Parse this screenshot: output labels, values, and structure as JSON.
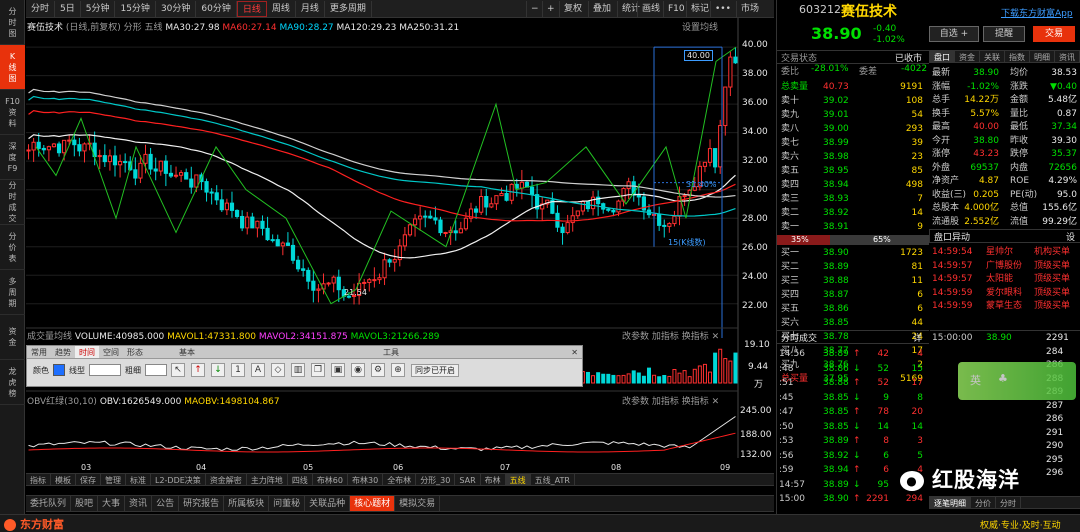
{
  "left_nav": [
    "分时图",
    "K线图",
    "F10资料",
    "深度F9",
    "分时成交",
    "分价表",
    "多周期",
    "资金",
    "龙虎榜"
  ],
  "timeframes": [
    "分时",
    "5日",
    "5分钟",
    "15分钟",
    "30分钟",
    "60分钟",
    "日线",
    "周线",
    "月线",
    "更多周期"
  ],
  "top_right": {
    "fuquan": "复权",
    "overlay": "叠加",
    "stat": "统计",
    "draw": "画线",
    "f10": "F10",
    "shortcut": "标记",
    "more": "•••",
    "market": "市场"
  },
  "chart_header": {
    "name": "赛伍技术",
    "info": "(日线,前复权) 分形 五线",
    "ma30": "MA30:27.98",
    "ma60": "MA60:27.14",
    "ma90": "MA90:28.27",
    "ma120": "MA120:29.23",
    "ma250": "MA250:31.21",
    "settings": "设置均线"
  },
  "price_axis": [
    "40.00",
    "38.00",
    "36.00",
    "34.00",
    "32.00",
    "30.00",
    "28.00",
    "26.00",
    "24.00",
    "22.00"
  ],
  "annotations": {
    "top_price": "40.00",
    "low_price": "21.54",
    "pct": "31.40%",
    "kbars": "15(K线数)"
  },
  "vol_header": {
    "label": "成交量均线",
    "vol": "VOLUME:40985.000",
    "mavol1": "MAVOL1:47331.800",
    "mavol2": "MAVOL2:34151.875",
    "mavol3": "MAVOL3:21266.289",
    "params": "改参数",
    "add": "加指标",
    "switch": "换指标"
  },
  "vol_axis": [
    "19.10",
    "9.44",
    "万"
  ],
  "obv_header": {
    "label": "OBV红绿(30,10)",
    "obv": "OBV:1626549.000",
    "maobv": "MAOBV:1498104.867"
  },
  "obv_axis": [
    "245.00",
    "188.00",
    "132.00"
  ],
  "x_axis": [
    "03",
    "04",
    "05",
    "06",
    "07",
    "08",
    "09"
  ],
  "toolbox": {
    "tabs": [
      "常用",
      "趋势",
      "时间",
      "空间",
      "形态"
    ],
    "section1": "基本",
    "section2": "工具",
    "color_label": "颜色",
    "line_label": "线型",
    "width_label": "粗细",
    "sync": "同步已开启"
  },
  "chart_tabs": [
    "指标",
    "模板",
    "保存",
    "管理",
    "标准",
    "L2-DDE决策",
    "资金解密",
    "主力阵地",
    "四线",
    "布林60",
    "布林30",
    "全布林",
    "分形_30",
    "SAR",
    "布林",
    "五线",
    "五线_ATR"
  ],
  "bottom_tabs": [
    "委托队列",
    "股吧",
    "大事",
    "资讯",
    "公告",
    "研究报告",
    "所属板块",
    "问董秘",
    "关联品种",
    "核心题材",
    "模拟交易"
  ],
  "logo": "东方财富",
  "slogan": "权威·专业·及时·互动",
  "right_panel": {
    "code": "603212",
    "name": "赛伍技术",
    "download": "下载东方财富App",
    "price": "38.90",
    "chg": "-0.40",
    "pct": "-1.02%",
    "btn_self": "自选 +",
    "btn_alert": "提醒",
    "btn_trade": "交易",
    "status_label": "交易状态",
    "status": "已收市",
    "tabs": [
      "盘口",
      "资金",
      "关联",
      "指数",
      "明细",
      "资讯"
    ],
    "weibi_label": "委比",
    "weibi": "-28.01%",
    "weicha_label": "委差",
    "weicha": "-4022",
    "sell_total_label": "总卖量",
    "sell_total_price": "40.73",
    "sell_total_vol": "9191",
    "sells": [
      [
        "卖十",
        "39.02",
        "108"
      ],
      [
        "卖九",
        "39.01",
        "54"
      ],
      [
        "卖八",
        "39.00",
        "293"
      ],
      [
        "卖七",
        "38.99",
        "39"
      ],
      [
        "卖六",
        "38.98",
        "23"
      ],
      [
        "卖五",
        "38.95",
        "85"
      ],
      [
        "卖四",
        "38.94",
        "498"
      ],
      [
        "卖三",
        "38.93",
        "7"
      ],
      [
        "卖二",
        "38.92",
        "14"
      ],
      [
        "卖一",
        "38.91",
        "9"
      ]
    ],
    "ratio_left": "35%",
    "ratio_right": "65%",
    "buys": [
      [
        "买一",
        "38.90",
        "1723"
      ],
      [
        "买二",
        "38.89",
        "81"
      ],
      [
        "买三",
        "38.88",
        "11"
      ],
      [
        "买四",
        "38.87",
        "6"
      ],
      [
        "买五",
        "38.86",
        "6"
      ],
      [
        "买六",
        "38.85",
        "44"
      ],
      [
        "买七",
        "38.78",
        "24"
      ],
      [
        "买八",
        "38.77",
        "17"
      ],
      [
        "买九",
        "38.76",
        "2"
      ]
    ],
    "buy_total_label": "总买量",
    "buy_total_price": "37.95",
    "buy_total_vol": "5169",
    "ticks_title": "分时成交",
    "ticks_more": "详",
    "ticks": [
      [
        "14:56",
        "38.89",
        "42",
        "4"
      ],
      [
        ":48",
        "38.86",
        "52",
        "15"
      ],
      [
        ":51",
        "38.88",
        "52",
        "17"
      ],
      [
        ":45",
        "38.85",
        "9",
        "8"
      ],
      [
        ":47",
        "38.85",
        "78",
        "20"
      ],
      [
        ":50",
        "38.85",
        "14",
        "14"
      ],
      [
        ":53",
        "38.89",
        "8",
        "3"
      ],
      [
        ":56",
        "38.92",
        "6",
        "5"
      ],
      [
        ":59",
        "38.94",
        "6",
        "4"
      ],
      [
        "14:57",
        "38.89",
        "95",
        "23"
      ],
      [
        "15:00",
        "38.90",
        "2291",
        "294"
      ]
    ],
    "stats": [
      [
        "最新",
        "38.90",
        "均价",
        "38.53"
      ],
      [
        "涨幅",
        "-1.02%",
        "涨跌",
        "▼0.40"
      ],
      [
        "总手",
        "14.22万",
        "金额",
        "5.48亿"
      ],
      [
        "换手",
        "5.57%",
        "量比",
        "0.87"
      ],
      [
        "最高",
        "40.00",
        "最低",
        "37.34"
      ],
      [
        "今开",
        "38.80",
        "昨收",
        "39.30"
      ],
      [
        "涨停",
        "43.23",
        "跌停",
        "35.37"
      ],
      [
        "外盘",
        "69537",
        "内盘",
        "72656"
      ],
      [
        "净资产",
        "4.87",
        "ROE",
        "4.29%"
      ],
      [
        "收益(三)",
        "0.205",
        "PE(动)",
        "95.0"
      ],
      [
        "总股本",
        "4.000亿",
        "总值",
        "155.6亿"
      ],
      [
        "流通股",
        "2.552亿",
        "流值",
        "99.29亿"
      ]
    ],
    "anomaly_title": "盘口异动",
    "anomaly_set": "设",
    "anomalies": [
      [
        "14:59:54",
        "星帅尔",
        "机构买单"
      ],
      [
        "14:59:57",
        "广博股份",
        "顶级买单"
      ],
      [
        "14:59:57",
        "太阳能",
        "顶级买单"
      ],
      [
        "14:59:59",
        "爱尔眼科",
        "顶级买单"
      ],
      [
        "14:59:59",
        "蒙草生态",
        "顶级买单"
      ]
    ],
    "mini_ticks": [
      [
        "15:00:00",
        "38.90",
        "2291"
      ],
      [
        "",
        "",
        "284"
      ],
      [
        "",
        "",
        "286"
      ],
      [
        "",
        "",
        "288"
      ],
      [
        "",
        "",
        "289"
      ],
      [
        "",
        "",
        "287"
      ],
      [
        "",
        "",
        "286"
      ],
      [
        "",
        "",
        "291"
      ],
      [
        "",
        "",
        "290"
      ],
      [
        "",
        "",
        "295"
      ],
      [
        "",
        "",
        "296"
      ]
    ],
    "bottom_tabs": [
      "逐笔明细",
      "分价",
      "分时"
    ],
    "popup": "英"
  },
  "watermark": "红股海洋"
}
